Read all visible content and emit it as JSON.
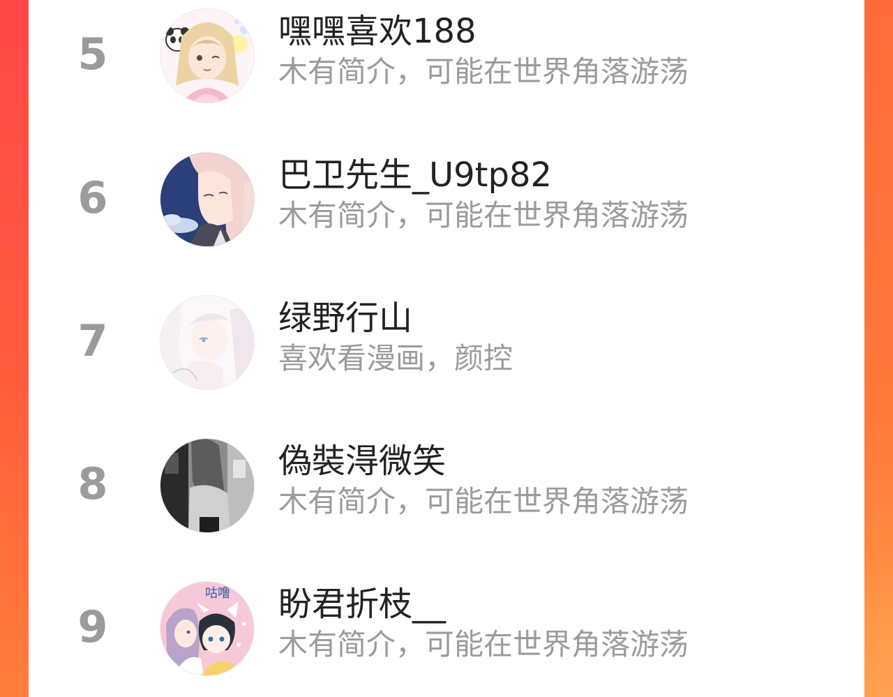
{
  "ranking": {
    "rows": [
      {
        "rank": "5",
        "name": "嘿嘿喜欢188",
        "bio": "木有简介，可能在世界角落游荡",
        "avatar_icon": "anime-girl-blonde-avatar"
      },
      {
        "rank": "6",
        "name": "巴卫先生_U9tp82",
        "bio": "木有简介，可能在世界角落游荡",
        "avatar_icon": "anime-fox-man-avatar"
      },
      {
        "rank": "7",
        "name": "绿野行山",
        "bio": "喜欢看漫画，颜控",
        "avatar_icon": "anime-white-hair-girl-avatar"
      },
      {
        "rank": "8",
        "name": "偽裝淂微笑",
        "bio": "木有简介，可能在世界角落游荡",
        "avatar_icon": "grayscale-photo-avatar"
      },
      {
        "rank": "9",
        "name": "盼君折枝__",
        "bio": "木有简介，可能在世界角落游荡",
        "avatar_icon": "anime-couple-avatar",
        "avatar_text": "咕噜"
      }
    ]
  },
  "colors": {
    "background_left": "#ff4848",
    "background_right": "#ff7a38",
    "panel": "#ffffff",
    "rank_text": "#9b9b9b",
    "name_text": "#222222",
    "bio_text": "#9b9b9b"
  }
}
